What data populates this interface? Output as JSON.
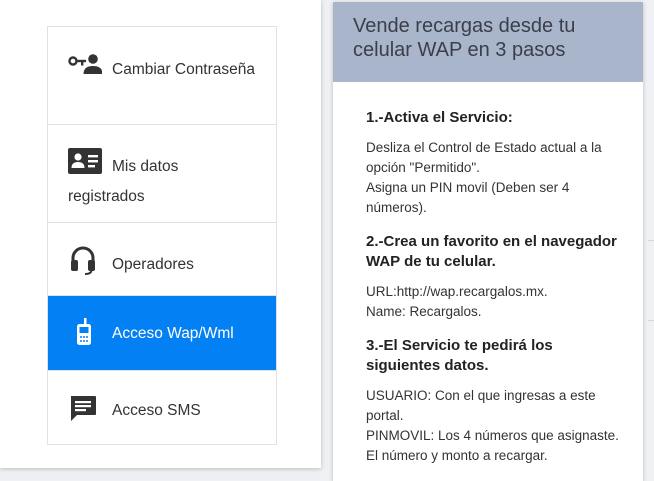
{
  "menu": {
    "items": [
      {
        "label": "Cambiar Contraseña",
        "icon": "user-key-icon",
        "active": false
      },
      {
        "label": "Mis datos registrados",
        "icon": "id-card-icon",
        "active": false
      },
      {
        "label": "Operadores",
        "icon": "headset-icon",
        "active": false
      },
      {
        "label": "Acceso Wap/Wml",
        "icon": "mobile-phone-icon",
        "active": true
      },
      {
        "label": "Acceso SMS",
        "icon": "chat-message-icon",
        "active": false
      }
    ]
  },
  "panel": {
    "title": "Vende recargas desde tu celular WAP en 3 pasos",
    "steps": [
      {
        "title": "1.-Activa el Servicio:",
        "lines": [
          "Desliza el Control de Estado actual a la opción \"Permitido\".",
          "Asigna un PIN movil (Deben ser 4 números)."
        ]
      },
      {
        "title": "2.-Crea un favorito en el navegador WAP de tu celular.",
        "lines": [
          "URL:http://wap.recargalos.mx.",
          "Name: Recargalos."
        ]
      },
      {
        "title": "3.-El Servicio te pedirá los siguientes datos.",
        "lines": [
          "USUARIO: Con el que ingresas a este portal.",
          "PINMOVIL: Los 4 números que asignaste.",
          "El número y monto a recargar."
        ]
      }
    ]
  },
  "colors": {
    "active_bg": "#0380f4",
    "header_bg": "#a9b5cb",
    "icon": "#333333"
  }
}
